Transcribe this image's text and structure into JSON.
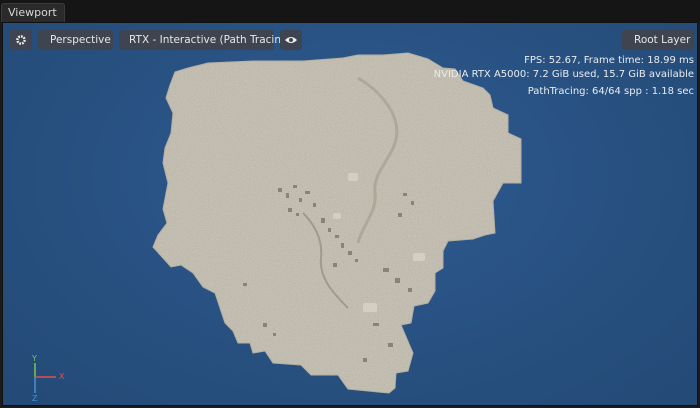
{
  "panel": {
    "tab_label": "Viewport"
  },
  "toolbar": {
    "camera_label": "Perspective",
    "renderer_label": "RTX - Interactive (Path Tracing)",
    "layer_label": "Root Layer"
  },
  "hud": {
    "fps_line": "FPS: 52.67, Frame time: 18.99 ms",
    "gpu_line": "NVIDIA RTX A5000: 7.2 GiB used,  15.7 GiB available",
    "pathtracing_line": "PathTracing: 64/64 spp : 1.18 sec"
  },
  "axes": {
    "y": "Y",
    "x": "X",
    "z": "Z"
  },
  "colors": {
    "viewport_bg": "#2b5182",
    "map_fill": "#c9c4b6",
    "axis_x": "#d9534f",
    "axis_y": "#79c45a",
    "axis_z": "#4a90d9"
  }
}
